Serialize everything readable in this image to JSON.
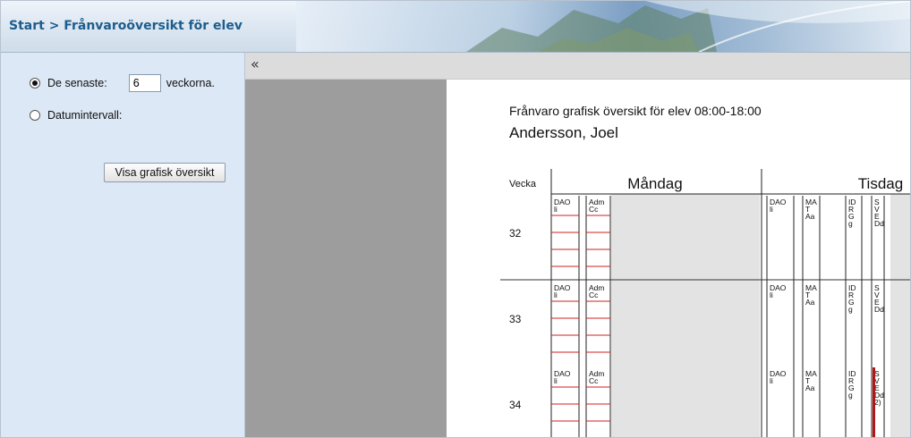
{
  "header": {
    "breadcrumb": "Start > Frånvaroöversikt för elev"
  },
  "left_panel": {
    "options": [
      {
        "label": "De senaste:",
        "checked": true,
        "value": "6",
        "suffix": "veckorna."
      },
      {
        "label": "Datumintervall:",
        "checked": false
      }
    ],
    "button_label": "Visa grafisk översikt"
  },
  "collapse_icon": "«",
  "report": {
    "title": "Frånvaro grafisk översikt för elev 08:00-18:00",
    "student": "Andersson, Joel",
    "week_header": "Vecka",
    "days": [
      "Måndag",
      "Tisdag"
    ],
    "weeks": [
      "32",
      "33",
      "34"
    ],
    "monday_lessons": [
      {
        "lines": [
          "DAO",
          "li"
        ]
      },
      {
        "lines": [
          "Adm",
          "Cc"
        ]
      }
    ],
    "tuesday_lessons": [
      {
        "lines": [
          "DAO",
          "li"
        ]
      },
      {
        "lines": [
          "MA",
          "T",
          "Aa"
        ]
      },
      {
        "lines": [
          "ID",
          "R",
          "G",
          "g"
        ]
      },
      {
        "lines": [
          "S",
          "V",
          "E",
          "Dd"
        ]
      }
    ],
    "week34_last_lesson": {
      "lines": [
        "S",
        "V",
        "E",
        "Dd",
        "2)"
      ]
    },
    "colors": {
      "absence": "#cc2222",
      "absence_bar": "#b01818",
      "shade": "#e3e3e3"
    }
  }
}
